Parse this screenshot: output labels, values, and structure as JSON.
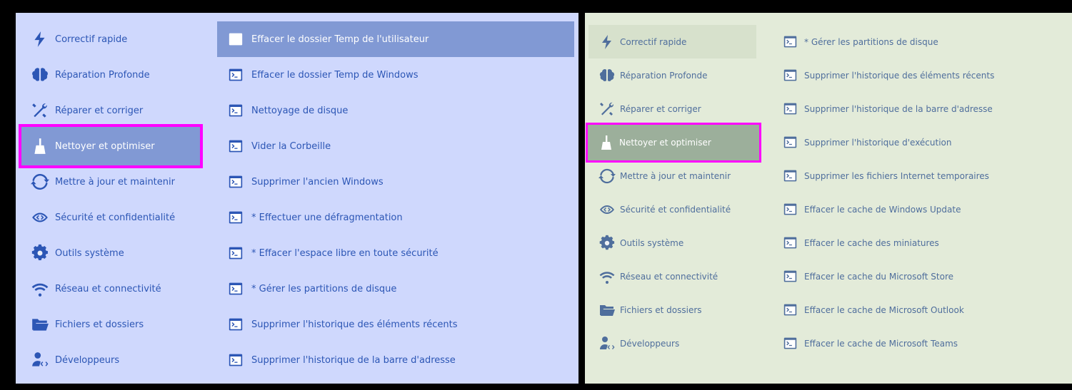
{
  "colors": {
    "left_background": "#cfd8fd",
    "left_text": "#2c56b5",
    "left_selected": "#8199d4",
    "right_background": "#e3ebd9",
    "right_text": "#4f6e9c",
    "right_selected": "#9caf9b",
    "highlight_outline": "#ff00ff"
  },
  "left_panel": {
    "categories": [
      {
        "label": "Correctif rapide",
        "icon": "lightning-icon"
      },
      {
        "label": "Réparation Profonde",
        "icon": "brain-icon"
      },
      {
        "label": "Réparer et corriger",
        "icon": "tools-icon"
      },
      {
        "label": "Nettoyer et optimiser",
        "icon": "broom-icon",
        "selected": true
      },
      {
        "label": "Mettre à jour et maintenir",
        "icon": "refresh-icon"
      },
      {
        "label": "Sécurité et confidentialité",
        "icon": "eye-code-icon"
      },
      {
        "label": "Outils système",
        "icon": "gear-icon"
      },
      {
        "label": "Réseau et connectivité",
        "icon": "wifi-icon"
      },
      {
        "label": "Fichiers et dossiers",
        "icon": "folder-icon"
      },
      {
        "label": "Développeurs",
        "icon": "developer-icon"
      }
    ],
    "actions": [
      {
        "label": "Effacer le dossier Temp de l'utilisateur",
        "icon": "terminal-icon",
        "selected": true
      },
      {
        "label": "Effacer le dossier Temp de Windows",
        "icon": "terminal-icon"
      },
      {
        "label": "Nettoyage de disque",
        "icon": "terminal-icon"
      },
      {
        "label": "Vider la Corbeille",
        "icon": "terminal-icon"
      },
      {
        "label": "Supprimer l'ancien Windows",
        "icon": "terminal-icon"
      },
      {
        "label": "* Effectuer une défragmentation",
        "icon": "terminal-icon"
      },
      {
        "label": "* Effacer l'espace libre en toute sécurité",
        "icon": "terminal-icon"
      },
      {
        "label": "* Gérer les partitions de disque",
        "icon": "terminal-icon"
      },
      {
        "label": "Supprimer l'historique des éléments récents",
        "icon": "terminal-icon"
      },
      {
        "label": "Supprimer l'historique de la barre d'adresse",
        "icon": "terminal-icon"
      }
    ]
  },
  "right_panel": {
    "categories": [
      {
        "label": "Correctif rapide",
        "icon": "lightning-icon",
        "hover": true
      },
      {
        "label": "Réparation Profonde",
        "icon": "brain-icon"
      },
      {
        "label": "Réparer et corriger",
        "icon": "tools-icon"
      },
      {
        "label": "Nettoyer et optimiser",
        "icon": "broom-icon",
        "selected": true
      },
      {
        "label": "Mettre à jour et maintenir",
        "icon": "refresh-icon"
      },
      {
        "label": "Sécurité et confidentialité",
        "icon": "eye-code-icon"
      },
      {
        "label": "Outils système",
        "icon": "gear-icon"
      },
      {
        "label": "Réseau et connectivité",
        "icon": "wifi-icon"
      },
      {
        "label": "Fichiers et dossiers",
        "icon": "folder-icon"
      },
      {
        "label": "Développeurs",
        "icon": "developer-icon"
      }
    ],
    "actions": [
      {
        "label": "* Gérer les partitions de disque",
        "icon": "terminal-icon"
      },
      {
        "label": "Supprimer l'historique des éléments récents",
        "icon": "terminal-icon"
      },
      {
        "label": "Supprimer l'historique de la barre d'adresse",
        "icon": "terminal-icon"
      },
      {
        "label": "Supprimer l'historique d'exécution",
        "icon": "terminal-icon"
      },
      {
        "label": "Supprimer les fichiers Internet temporaires",
        "icon": "terminal-icon"
      },
      {
        "label": "Effacer le cache de Windows Update",
        "icon": "terminal-icon"
      },
      {
        "label": "Effacer le cache des miniatures",
        "icon": "terminal-icon"
      },
      {
        "label": "Effacer le cache du Microsoft Store",
        "icon": "terminal-icon"
      },
      {
        "label": "Effacer le cache de Microsoft Outlook",
        "icon": "terminal-icon"
      },
      {
        "label": "Effacer le cache de Microsoft Teams",
        "icon": "terminal-icon"
      }
    ]
  }
}
